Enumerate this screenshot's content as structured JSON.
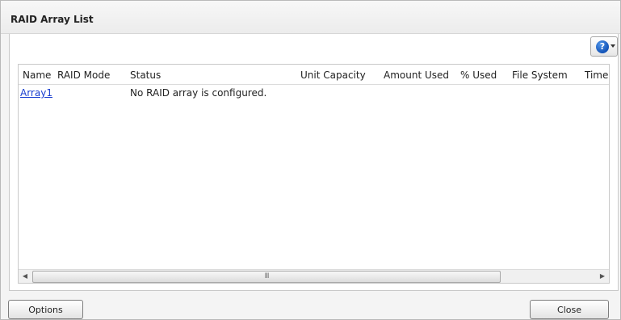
{
  "window": {
    "title": "RAID Array List"
  },
  "help": {
    "glyph": "?",
    "icon": "help-icon"
  },
  "table": {
    "columns": [
      "Name",
      "RAID Mode",
      "Status",
      "Unit Capacity",
      "Amount Used",
      "% Used",
      "File System",
      "Time Re"
    ],
    "rows": [
      {
        "name": "Array1",
        "raid_mode": "",
        "status": "No RAID array is configured."
      }
    ]
  },
  "scrollbar": {
    "left_arrow": "◀",
    "right_arrow": "▶",
    "grip": "III"
  },
  "footer": {
    "options_label": "Options",
    "close_label": "Close"
  },
  "colors": {
    "link": "#1a3fd0",
    "help_icon": "#1454b8"
  }
}
